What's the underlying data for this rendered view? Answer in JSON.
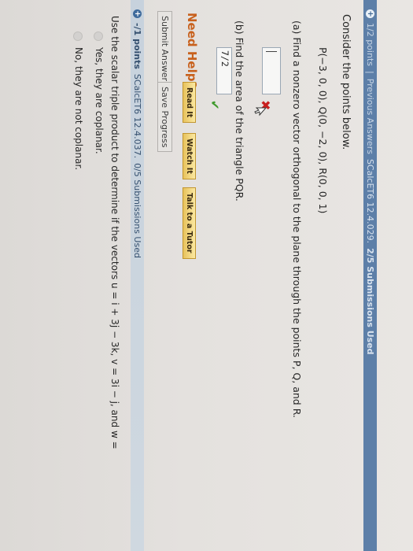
{
  "header_top": {
    "points": "1/2 points",
    "separator": "|",
    "prev": "Previous Answers",
    "code": "SCalcET6 12.4.029.",
    "submissions": "2/5 Submissions Used"
  },
  "problem1": {
    "intro": "Consider the points below.",
    "points_text": "P(−3, 0, 0),      Q(0, −2, 0),      R(0, 0, 1)",
    "part_a": "(a) Find a nonzero vector orthogonal to the plane through the points P, Q, and R.",
    "part_a_value": "",
    "part_b": "(b) Find the area of the triangle PQR.",
    "part_b_value": "7/2"
  },
  "help": {
    "label": "Need Help?",
    "read": "Read It",
    "watch": "Watch It",
    "tutor": "Talk to a Tutor"
  },
  "actions": {
    "submit": "Submit Answer",
    "save": "Save Progress"
  },
  "header_bottom": {
    "points": "-/1 points",
    "code": "SCalcET6 12.4.037.",
    "submissions": "0/5 Submissions Used"
  },
  "problem2": {
    "question": "Use the scalar triple product to determine if the vectors u = i + 3j − 3k, v = 3i − j, and w =",
    "option_yes": "Yes, they are coplanar.",
    "option_no": "No, they are not coplanar."
  },
  "colors": {
    "header_blue": "#5d7fa8",
    "help_orange": "#c8611d",
    "incorrect_red": "#c81e1e",
    "correct_green": "#3e9a2c"
  }
}
